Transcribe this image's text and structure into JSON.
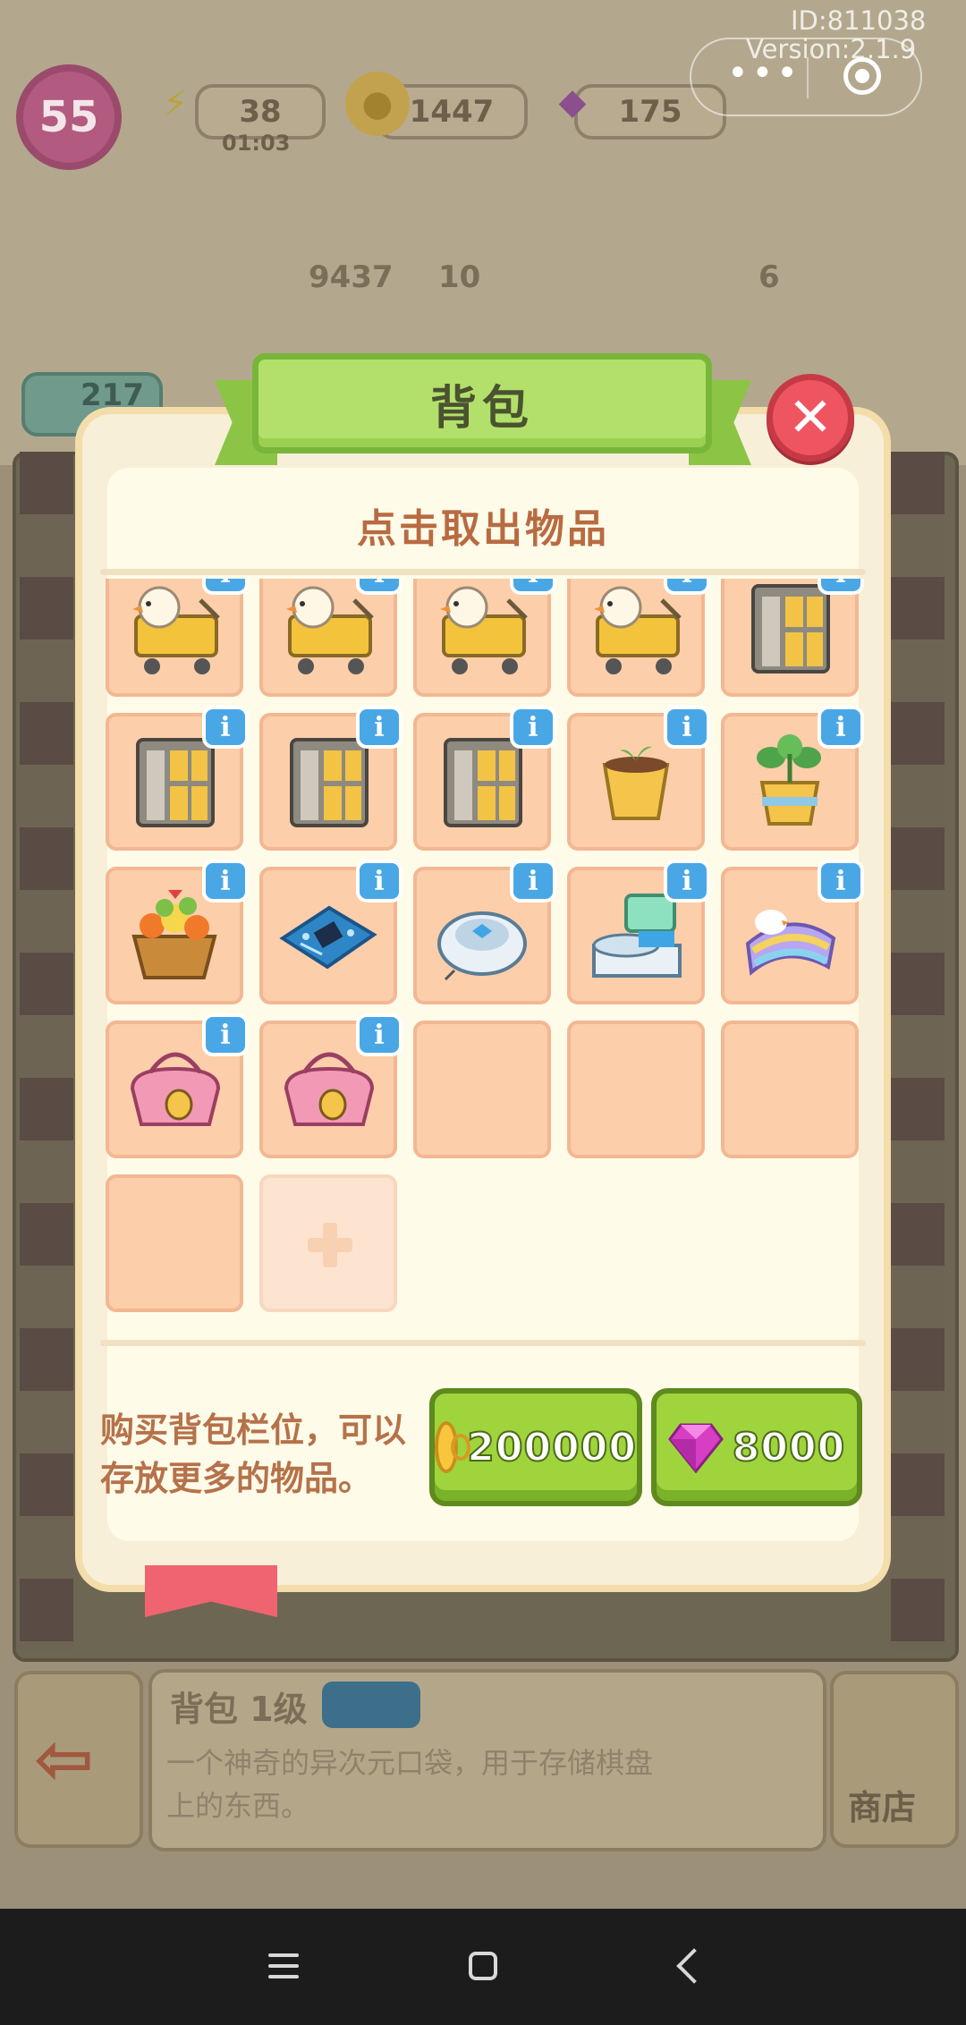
{
  "system": {
    "id_label": "ID:811038",
    "version_label": "Version:2.1.9"
  },
  "hud": {
    "level": "55",
    "energy": "38",
    "energy_timer": "01:03",
    "coins": "1447",
    "gems": "175"
  },
  "background": {
    "score": "9437",
    "stars_a": "10",
    "stars_b": "6",
    "player_stars": "217",
    "item_title": "背包 1级",
    "item_desc_line1": "一个神奇的异次元口袋，用于存储棋盘",
    "item_desc_line2": "上的东西。",
    "shop_label": "商店"
  },
  "backpack": {
    "title": "背包",
    "subtitle": "点击取出物品",
    "info_badge": "i",
    "slots": [
      {
        "item": "shopping-cart-duck",
        "has_info": true
      },
      {
        "item": "shopping-cart-duck",
        "has_info": true
      },
      {
        "item": "shopping-cart-duck",
        "has_info": true
      },
      {
        "item": "shopping-cart-duck",
        "has_info": true
      },
      {
        "item": "locker-cabinet",
        "has_info": true
      },
      {
        "item": "locker-cabinet",
        "has_info": true
      },
      {
        "item": "locker-cabinet",
        "has_info": true
      },
      {
        "item": "locker-cabinet",
        "has_info": true
      },
      {
        "item": "seedling-pot",
        "has_info": true
      },
      {
        "item": "plant-pot",
        "has_info": true
      },
      {
        "item": "flower-basket",
        "has_info": true
      },
      {
        "item": "circuit-board",
        "has_info": true
      },
      {
        "item": "robot-vacuum",
        "has_info": true
      },
      {
        "item": "vacuum-dock",
        "has_info": true
      },
      {
        "item": "striped-bed",
        "has_info": true
      },
      {
        "item": "pink-bag",
        "has_info": true
      },
      {
        "item": "pink-bag",
        "has_info": true
      },
      {
        "item": "empty"
      },
      {
        "item": "empty"
      },
      {
        "item": "empty"
      },
      {
        "item": "empty"
      },
      {
        "item": "locked-add-slot"
      }
    ],
    "buy_description": "购买背包栏位，可以存放更多的物品。",
    "buy_with_coins": "200000",
    "buy_with_gems": "8000"
  },
  "colors": {
    "panel": "#f8efd8",
    "slot": "#fcceaa",
    "ribbon": "#b2e06a",
    "buy_button": "#9fd43d",
    "close_button": "#ef5561",
    "info_badge": "#4aa7e6"
  }
}
